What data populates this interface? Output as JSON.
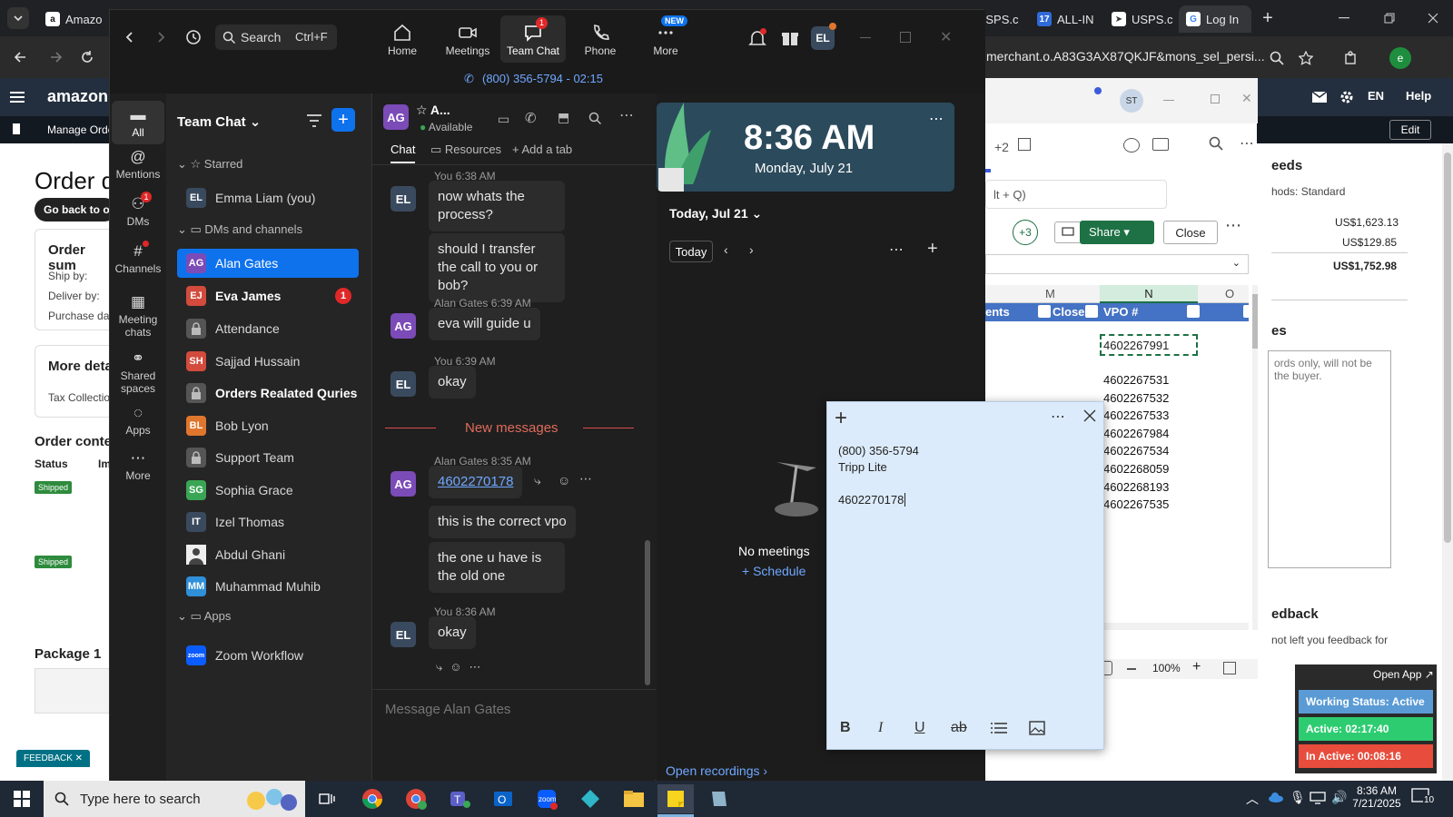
{
  "browser": {
    "tabs": [
      {
        "label": "Amazo",
        "icon": "amazon-icon"
      },
      {
        "label": "USPS.c",
        "icon": "usps-icon"
      },
      {
        "label": "ALL-IN",
        "icon": "seventeen-track-icon"
      },
      {
        "label": "USPS.c",
        "icon": "usps-icon"
      },
      {
        "label": "Log In",
        "icon": "google-icon"
      }
    ],
    "address": "merchant.o.A83G3AX87QKJF&mons_sel_persi..."
  },
  "amazon": {
    "logo": "amazon se",
    "manage_orders": "Manage Order",
    "lang": "EN",
    "help": "Help",
    "edit": "Edit",
    "order_title": "Order de",
    "go_back": "Go back to ord",
    "order_summary": "Order sum",
    "ship_by": "Ship by:",
    "deliver_by": "Deliver by:",
    "purchase_date": "Purchase dat",
    "more_details": "More deta",
    "tax_collection": "Tax Collectio",
    "order_contents": "Order conte",
    "status_col": "Status",
    "im_col": "Im",
    "shipped": "Shipped",
    "package": "Package 1",
    "feedback_tab": "FEEDBACK",
    "right": {
      "needs": "eeds",
      "methods": "hods: Standard",
      "amount1": "US$1,623.13",
      "amount2": "US$129.85",
      "total": "US$1,752.98",
      "notes_header": "es",
      "notes_text": "ords only, will not be\nthe buyer.",
      "feedback": "edback",
      "feedback_text": "not left you feedback for"
    }
  },
  "status_widget": {
    "open_app": "Open App ↗",
    "working": "Working Status: Active",
    "active": "Active: 02:17:40",
    "inactive": "In Active: 00:08:16"
  },
  "excel": {
    "extra_count": "+2",
    "search_hint": "lt + Q)",
    "plus3": "+3",
    "share": "Share",
    "close": "Close",
    "cols": [
      "M",
      "N",
      "O"
    ],
    "headers": [
      "ents",
      "Closed",
      "VPO #"
    ],
    "selected_value": "4602267991",
    "values": [
      "4602267531",
      "4602267532",
      "4602267533",
      "4602267984",
      "4602267534",
      "4602268059",
      "4602268193",
      "4602267535"
    ],
    "zoom": "100%"
  },
  "zoom": {
    "search": "Search",
    "shortcut": "Ctrl+F",
    "nav": [
      {
        "label": "Home",
        "icon": "home-icon"
      },
      {
        "label": "Meetings",
        "icon": "video-icon"
      },
      {
        "label": "Team Chat",
        "icon": "chat-icon",
        "badge": "1"
      },
      {
        "label": "Phone",
        "icon": "phone-icon"
      },
      {
        "label": "More",
        "icon": "more-icon",
        "badge": "NEW"
      }
    ],
    "user_initials": "EL",
    "call": "(800) 356-5794 - 02:15",
    "rail": [
      {
        "label": "All",
        "icon": "chat-bubble-icon"
      },
      {
        "label": "Mentions",
        "icon": "at-icon"
      },
      {
        "label": "DMs",
        "icon": "people-icon",
        "badge": "1"
      },
      {
        "label": "Channels",
        "icon": "hash-icon"
      },
      {
        "label": "Meeting chats",
        "icon": "calendar-icon"
      },
      {
        "label": "Shared spaces",
        "icon": "share-nodes-icon"
      },
      {
        "label": "Apps",
        "icon": "apps-icon"
      },
      {
        "label": "More",
        "icon": "more-icon"
      }
    ],
    "list_title": "Team Chat",
    "starred": "Starred",
    "dms_channels": "DMs and channels",
    "apps_section": "Apps",
    "contacts": [
      {
        "name": "Emma Liam (you)",
        "initials": "EL",
        "color": "#3a4a5e",
        "section": "starred"
      },
      {
        "name": "Alan Gates",
        "initials": "AG",
        "color": "#7b4bb7",
        "selected": true
      },
      {
        "name": "Eva James",
        "initials": "EJ",
        "color": "#d24b3c",
        "bold": true,
        "badge": "1"
      },
      {
        "name": "Attendance",
        "initials": "",
        "color": "#555555",
        "lock": true
      },
      {
        "name": "Sajjad Hussain",
        "initials": "SH",
        "color": "#d24b3c"
      },
      {
        "name": "Orders Realated Quries",
        "initials": "",
        "color": "#555555",
        "lock": true,
        "bold": true
      },
      {
        "name": "Bob Lyon",
        "initials": "BL",
        "color": "#e0762e"
      },
      {
        "name": "Support Team",
        "initials": "",
        "color": "#555555",
        "lock": true
      },
      {
        "name": "Sophia Grace",
        "initials": "SG",
        "color": "#3aa655"
      },
      {
        "name": "Izel Thomas",
        "initials": "IT",
        "color": "#3a4a5e"
      },
      {
        "name": "Abdul Ghani",
        "initials": "",
        "color": "#dddddd",
        "photo": true
      },
      {
        "name": "Muhammad Muhib",
        "initials": "MM",
        "color": "#2f8fd8"
      }
    ],
    "app_item": "Zoom Workflow",
    "app_icon_label": "zoom",
    "chat_header": {
      "initials": "AG",
      "name": "A...",
      "status": "Available"
    },
    "chat_tabs": [
      "Chat",
      "Resources",
      "Add a tab"
    ],
    "messages": {
      "m0_meta": "You 6:38 AM",
      "m1": "now whats the process?",
      "m2": "should I transfer the call to you or bob?",
      "m3_meta": "Alan Gates 6:39 AM",
      "m3": "eva will guide u",
      "m4_meta": "You 6:39 AM",
      "m4": "okay",
      "new_messages": "New messages",
      "m5_meta": "Alan Gates 8:35 AM",
      "m5": "4602270178",
      "m6": "this is the correct vpo",
      "m7": "the one u have is the old one",
      "m8_meta": "You 8:36 AM",
      "m8": "okay"
    },
    "composer_placeholder": "Message Alan Gates",
    "calendar": {
      "time": "8:36 AM",
      "date": "Monday, July 21",
      "today_label": "Today, Jul 21",
      "today_btn": "Today",
      "no_meetings": "No meetings",
      "schedule": "Schedule",
      "open_recordings": "Open recordings"
    }
  },
  "sticky": {
    "line1": "(800) 356-5794",
    "line2": "Tripp Lite",
    "line3": "4602270178"
  },
  "taskbar": {
    "search": "Type here to search",
    "time": "8:36 AM",
    "date": "7/21/2025",
    "notif": "10"
  },
  "colors": {
    "zoom_blue": "#0b5cff",
    "selected": "#0e72ed",
    "excel_green": "#1e7145",
    "sticky": "#dcebfb",
    "status_blue": "#5b9bd5",
    "status_green": "#2ecc71",
    "status_red": "#e74c3c"
  }
}
